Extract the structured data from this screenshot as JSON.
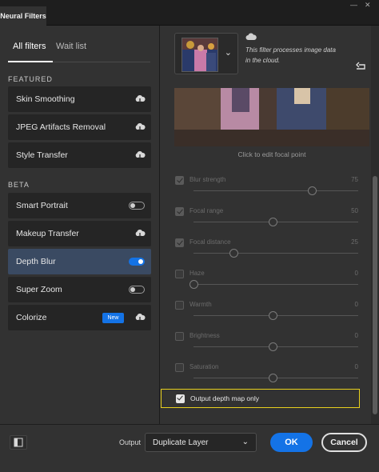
{
  "window": {
    "title": "Neural Filters",
    "controls": [
      "minimize",
      "close"
    ]
  },
  "left_panel": {
    "tabs": [
      {
        "label": "All filters",
        "active": true
      },
      {
        "label": "Wait list",
        "active": false
      }
    ],
    "sections": [
      {
        "label": "FEATURED",
        "items": [
          {
            "label": "Skin Smoothing",
            "icon": "cloud-download-icon"
          },
          {
            "label": "JPEG Artifacts Removal",
            "icon": "cloud-download-icon"
          },
          {
            "label": "Style Transfer",
            "icon": "cloud-download-icon"
          }
        ]
      },
      {
        "label": "BETA",
        "items": [
          {
            "label": "Smart Portrait",
            "toggle": "off"
          },
          {
            "label": "Makeup Transfer",
            "icon": "cloud-download-icon"
          },
          {
            "label": "Depth Blur",
            "toggle": "on",
            "selected": true
          },
          {
            "label": "Super Zoom",
            "toggle": "off"
          },
          {
            "label": "Colorize",
            "badge": "New",
            "icon": "cloud-download-icon"
          }
        ]
      }
    ]
  },
  "right_panel": {
    "cloud_notice": "This filter processes image data in the cloud.",
    "focal_caption": "Click to edit focal point",
    "sliders": [
      {
        "label": "Blur strength",
        "value": "75",
        "checked": true
      },
      {
        "label": "Focal range",
        "value": "50",
        "checked": true
      },
      {
        "label": "Focal distance",
        "value": "25",
        "checked": true
      },
      {
        "label": "Haze",
        "value": "0",
        "checked": false
      },
      {
        "label": "Warmth",
        "value": "0",
        "checked": false
      },
      {
        "label": "Brightness",
        "value": "0",
        "checked": false
      },
      {
        "label": "Saturation",
        "value": "0",
        "checked": false
      }
    ],
    "output_depth": {
      "label": "Output depth map only",
      "checked": true
    }
  },
  "bottom_bar": {
    "output_label": "Output",
    "output_value": "Duplicate Layer",
    "ok_label": "OK",
    "cancel_label": "Cancel"
  },
  "colors": {
    "accent": "#1473e6",
    "highlight": "#e8d01e",
    "selected_row": "#3a4a62"
  }
}
